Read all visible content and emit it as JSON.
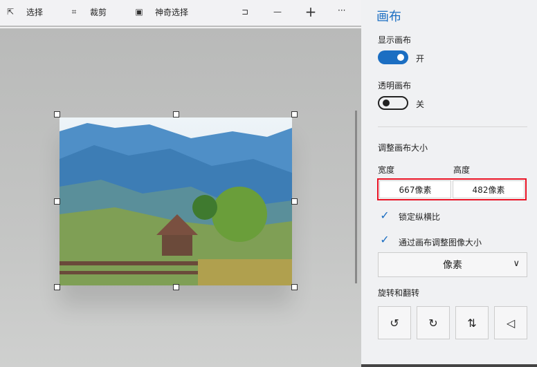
{
  "toolbar": {
    "select": "选择",
    "crop": "裁剪",
    "magic_select": "神奇选择",
    "more": "···"
  },
  "panel": {
    "title": "画布",
    "show_canvas": {
      "label": "显示画布",
      "state": "开"
    },
    "transparent_canvas": {
      "label": "透明画布",
      "state": "关"
    },
    "resize_title": "调整画布大小",
    "width_label": "宽度",
    "height_label": "高度",
    "width_value": "667像素",
    "height_value": "482像素",
    "lock_aspect": "锁定纵横比",
    "resize_image": "通过画布调整图像大小",
    "unit": "像素",
    "rotate_title": "旋转和翻转"
  },
  "colors": {
    "accent": "#1b6ec2",
    "highlight": "#e81123"
  }
}
